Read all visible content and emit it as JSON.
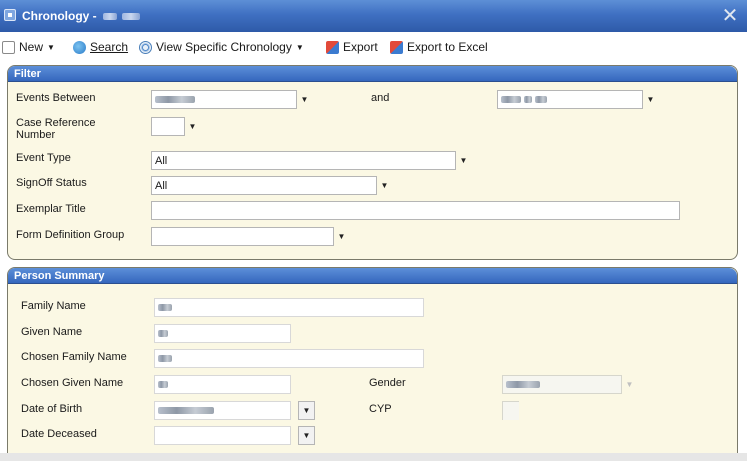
{
  "window": {
    "title": "Chronology -",
    "close_glyph": "✕"
  },
  "toolbar": {
    "new_label": "New",
    "search_label": "Search",
    "view_label": "View Specific Chronology",
    "export_label": "Export",
    "export_excel_label": "Export to Excel"
  },
  "filter": {
    "header": "Filter",
    "events_between_label": "Events Between",
    "and_label": "and",
    "case_ref_label_1": "Case Reference",
    "case_ref_label_2": "Number",
    "event_type_label": "Event Type",
    "event_type_value": "All",
    "signoff_label": "SignOff Status",
    "signoff_value": "All",
    "exemplar_label": "Exemplar Title",
    "exemplar_value": "",
    "form_def_label": "Form Definition Group",
    "form_def_value": ""
  },
  "person": {
    "header": "Person Summary",
    "family_name_label": "Family Name",
    "given_name_label": "Given Name",
    "chosen_family_label": "Chosen Family Name",
    "chosen_given_label": "Chosen Given Name",
    "gender_label": "Gender",
    "dob_label": "Date of Birth",
    "cyp_label": "CYP",
    "deceased_label": "Date Deceased",
    "deceased_value": ""
  },
  "icons": {
    "app": "window-icon",
    "new": "document-icon",
    "search": "search-icon",
    "view": "view-icon",
    "export": "export-icon",
    "dropdown": "chevron-down-icon"
  }
}
